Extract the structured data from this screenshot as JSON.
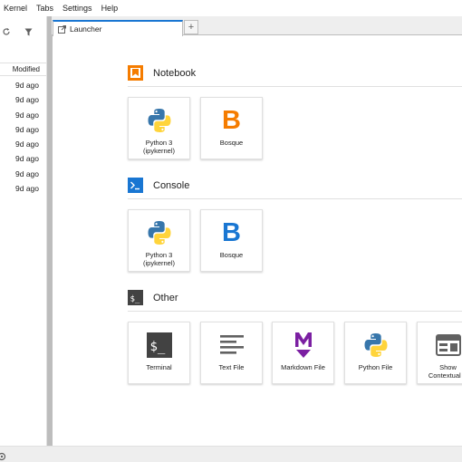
{
  "menubar": {
    "items": [
      "Kernel",
      "Tabs",
      "Settings",
      "Help"
    ]
  },
  "file_browser": {
    "column_header": "Modified",
    "rows": [
      "9d ago",
      "9d ago",
      "9d ago",
      "9d ago",
      "9d ago",
      "9d ago",
      "9d ago",
      "9d ago"
    ],
    "icons": [
      "refresh-icon",
      "filter-icon"
    ]
  },
  "tabs": [
    {
      "label": "Launcher",
      "icon": "launcher-icon",
      "close": "×"
    }
  ],
  "add_tab_label": "+",
  "launcher": {
    "sections": [
      {
        "title": "Notebook",
        "icon": "notebook-icon",
        "cards": [
          {
            "label": "Python 3\n(ipykernel)",
            "icon": "python-icon"
          },
          {
            "label": "Bosque",
            "icon": "bosque-icon",
            "glyph": "B",
            "color": "#F57C00"
          }
        ]
      },
      {
        "title": "Console",
        "icon": "console-icon",
        "cards": [
          {
            "label": "Python 3\n(ipykernel)",
            "icon": "python-icon"
          },
          {
            "label": "Bosque",
            "icon": "bosque-icon",
            "glyph": "B",
            "color": "#1976D2"
          }
        ]
      },
      {
        "title": "Other",
        "icon": "terminal-section-icon",
        "cards": [
          {
            "label": "Terminal",
            "icon": "terminal-icon"
          },
          {
            "label": "Text File",
            "icon": "text-file-icon"
          },
          {
            "label": "Markdown File",
            "icon": "markdown-icon"
          },
          {
            "label": "Python File",
            "icon": "python-icon"
          },
          {
            "label": "Show\nContextual H",
            "icon": "contextual-help-icon"
          }
        ]
      }
    ]
  },
  "colors": {
    "accent": "#1976D2",
    "notebook_orange": "#F57C00",
    "console_blue": "#1976D2",
    "markdown_purple": "#7B1FA2",
    "python_blue": "#3776AB",
    "python_yellow": "#FFD43B"
  }
}
